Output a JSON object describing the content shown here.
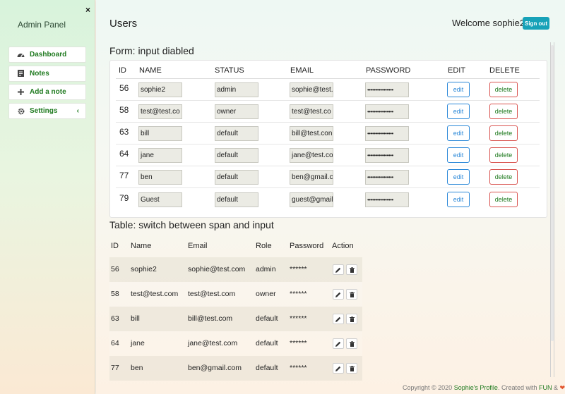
{
  "sidebar": {
    "brand": "Admin Panel",
    "close_glyph": "×",
    "items": [
      {
        "label": "Dashboard",
        "icon": "dashboard-icon"
      },
      {
        "label": "Notes",
        "icon": "notes-icon"
      },
      {
        "label": "Add a note",
        "icon": "plus-icon"
      },
      {
        "label": "Settings",
        "icon": "gear-icon",
        "chevron": "‹"
      }
    ]
  },
  "header": {
    "title": "Users",
    "welcome": "Welcome sophie2,",
    "signout": "Sign out"
  },
  "form_section": {
    "title": "Form: input diabled",
    "columns": [
      "ID",
      "NAME",
      "STATUS",
      "EMAIL",
      "PASSWORD",
      "EDIT",
      "DELETE"
    ],
    "edit_label": "edit",
    "delete_label": "delete",
    "password_mask": "••••••••••••••••",
    "rows": [
      {
        "id": "56",
        "name": "sophie2",
        "status": "admin",
        "email": "sophie@test."
      },
      {
        "id": "58",
        "name": "test@test.co",
        "status": "owner",
        "email": "test@test.co"
      },
      {
        "id": "63",
        "name": "bill",
        "status": "default",
        "email": "bill@test.con"
      },
      {
        "id": "64",
        "name": "jane",
        "status": "default",
        "email": "jane@test.co"
      },
      {
        "id": "77",
        "name": "ben",
        "status": "default",
        "email": "ben@gmail.c"
      },
      {
        "id": "79",
        "name": "Guest",
        "status": "default",
        "email": "guest@gmail"
      }
    ]
  },
  "table_section": {
    "title": "Table: switch between span and input",
    "columns": [
      "ID",
      "Name",
      "Email",
      "Role",
      "Password",
      "Action"
    ],
    "rows": [
      {
        "id": "56",
        "name": "sophie2",
        "email": "sophie@test.com",
        "role": "admin",
        "password": "******"
      },
      {
        "id": "58",
        "name": "test@test.com",
        "email": "test@test.com",
        "role": "owner",
        "password": "******"
      },
      {
        "id": "63",
        "name": "bill",
        "email": "bill@test.com",
        "role": "default",
        "password": "******"
      },
      {
        "id": "64",
        "name": "jane",
        "email": "jane@test.com",
        "role": "default",
        "password": "******"
      },
      {
        "id": "77",
        "name": "ben",
        "email": "ben@gmail.com",
        "role": "default",
        "password": "******"
      }
    ]
  },
  "footer": {
    "copyright": "Copyright © 2020",
    "profile": "Sophie's Profile",
    "created_with": ". Created with",
    "fun": "FUN",
    "amp": "&"
  },
  "colors": {
    "accent_green": "#1f7a1f",
    "signout_teal": "#17a2b8",
    "edit_blue": "#2b88d8",
    "delete_red": "#d9534f",
    "heart": "#e2542d"
  }
}
